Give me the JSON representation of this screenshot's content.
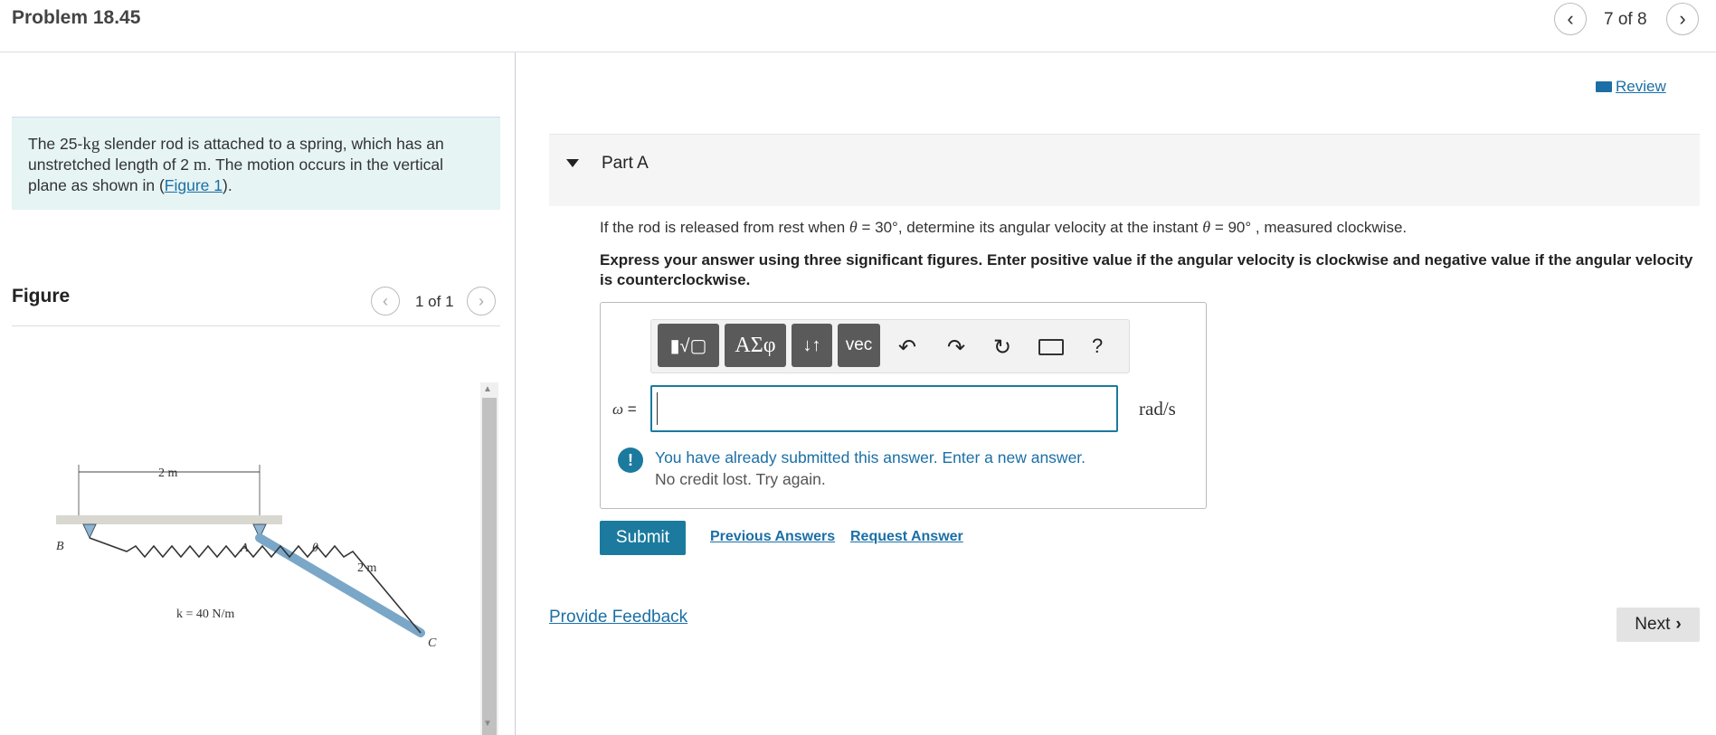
{
  "header": {
    "title": "Problem 18.45",
    "prev_icon": "chevron-left-icon",
    "page_counter": "7 of 8",
    "next_icon": "chevron-right-icon"
  },
  "problem": {
    "text_before_mass": "The 25-",
    "mass_unit": "kg",
    "text_mid": " slender rod is attached to a spring, which has an unstretched length of 2 ",
    "length_unit": "m",
    "text_end": ". The motion occurs in the vertical plane as shown in (",
    "figure_link": "Figure 1",
    "text_close": ")."
  },
  "figure": {
    "heading": "Figure",
    "counter": "1 of 1",
    "labels": {
      "dim_top": "2 m",
      "dim_rod": "2 m",
      "point_b": "B",
      "point_a": "A",
      "point_c": "C",
      "angle": "θ",
      "spring": "k = 40 N/m"
    }
  },
  "review": {
    "label": "Review",
    "icon": "book-icon"
  },
  "part": {
    "title": "Part A",
    "question_prefix": "If the rod is released from rest when ",
    "theta1": "θ",
    "eq1": " = 30°",
    "question_mid": ", determine its angular velocity at the instant ",
    "theta2": "θ",
    "eq2": " = 90°",
    "question_suffix": " , measured clockwise.",
    "instructions": "Express your answer using three significant figures. Enter positive value if the angular velocity is clockwise and negative value if the angular velocity is counterclockwise."
  },
  "toolbar": {
    "templates": "▮√▢",
    "greek": "ΑΣφ",
    "arrows": "↓↑",
    "vec": "vec",
    "undo_icon": "undo-icon",
    "redo_icon": "redo-icon",
    "reset_icon": "reset-icon",
    "keyboard_icon": "keyboard-icon",
    "help": "?"
  },
  "answer": {
    "variable": "ω",
    "equals": " =",
    "value": "",
    "unit": "rad/s"
  },
  "alert": {
    "icon": "!",
    "line1": "You have already submitted this answer. Enter a new answer.",
    "line2": "No credit lost. Try again."
  },
  "actions": {
    "submit": "Submit",
    "previous_answers": "Previous Answers",
    "request_answer": "Request Answer",
    "feedback": "Provide Feedback",
    "next": "Next"
  }
}
